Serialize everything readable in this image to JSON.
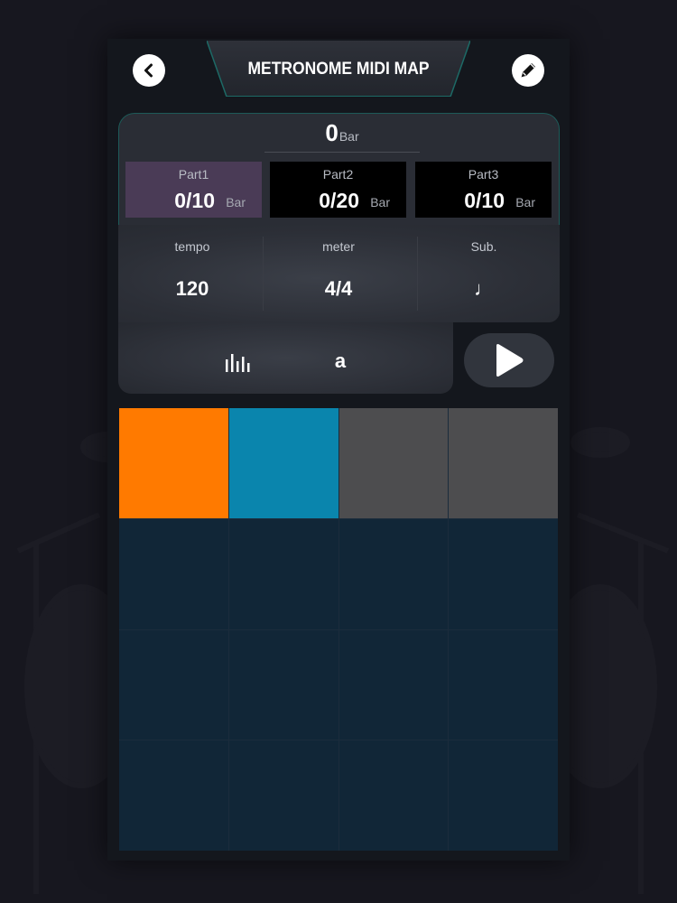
{
  "header": {
    "title": "METRONOME MIDI MAP",
    "back_icon": "chevron-left-icon",
    "edit_icon": "pencil-icon"
  },
  "bar_counter": {
    "value": "0",
    "unit": "Bar"
  },
  "parts": [
    {
      "label": "Part1",
      "value": "0/10",
      "unit": "Bar",
      "active": true
    },
    {
      "label": "Part2",
      "value": "0/20",
      "unit": "Bar",
      "active": false
    },
    {
      "label": "Part3",
      "value": "0/10",
      "unit": "Bar",
      "active": false
    }
  ],
  "params": {
    "tempo": {
      "label": "tempo",
      "value": "120"
    },
    "meter": {
      "label": "meter",
      "value": "4/4"
    },
    "sub": {
      "label": "Sub.",
      "value": "♩"
    }
  },
  "controls": {
    "accent_label": "a",
    "volume_icon": "bar-levels-icon",
    "play_icon": "play-icon"
  },
  "pads": {
    "colors": [
      "#ff7a00",
      "#0a85ad",
      "#4d4d4f",
      "#4d4d4f",
      "#112637",
      "#112637",
      "#112637",
      "#112637",
      "#112637",
      "#112637",
      "#112637",
      "#112637",
      "#112637",
      "#112637",
      "#112637",
      "#112637"
    ]
  },
  "colors": {
    "part_active": "#4a3b56",
    "panel_border": "#1d5a58",
    "background": "#17171f"
  }
}
